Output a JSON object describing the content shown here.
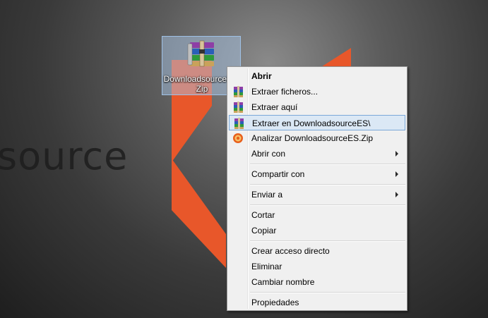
{
  "desktop": {
    "wallpaper_text": "source",
    "file_icon": {
      "label_line1": "DownloadsourceES.",
      "label_line2": "Zip"
    }
  },
  "context_menu": {
    "items": [
      {
        "label": "Abrir",
        "bold": true
      },
      {
        "label": "Extraer ficheros...",
        "icon": "winrar-icon"
      },
      {
        "label": "Extraer aquí",
        "icon": "winrar-icon"
      },
      {
        "label": "Extraer en DownloadsourceES\\",
        "icon": "winrar-icon",
        "highlighted": true
      },
      {
        "label": "Analizar DownloadsourceES.Zip",
        "icon": "antivirus-icon"
      },
      {
        "label": "Abrir con",
        "submenu": true
      },
      {
        "label": "Compartir con",
        "submenu": true
      },
      {
        "label": "Enviar a",
        "submenu": true
      },
      {
        "label": "Cortar"
      },
      {
        "label": "Copiar"
      },
      {
        "label": "Crear acceso directo"
      },
      {
        "label": "Eliminar"
      },
      {
        "label": "Cambiar nombre"
      },
      {
        "label": "Propiedades"
      }
    ]
  },
  "colors": {
    "wallpaper_accent": "#e8572a",
    "highlight_bg": "#dbe8f5",
    "highlight_border": "#7aa7d8",
    "menu_bg": "#f0f0f0"
  }
}
